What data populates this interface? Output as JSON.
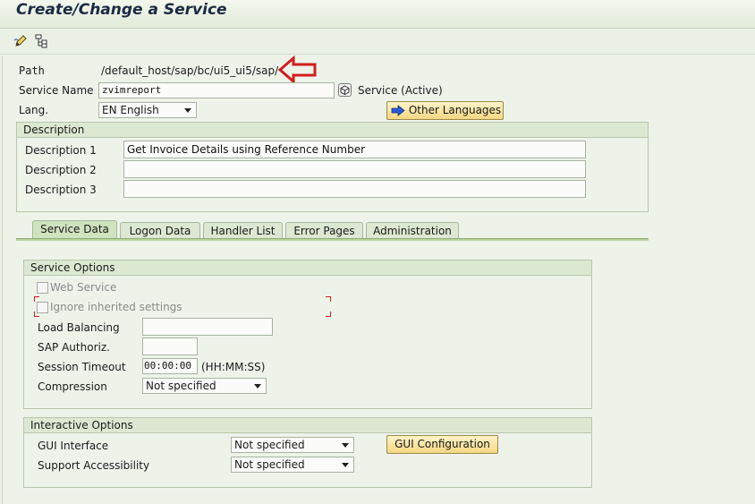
{
  "title": "Create/Change a Service",
  "toolbar": {
    "icons": [
      "edit-pencil-icon",
      "hierarchy-icon"
    ]
  },
  "path": {
    "label": "Path",
    "value": "/default_host/sap/bc/ui5_ui5/sap/"
  },
  "service_name": {
    "label": "Service Name",
    "value": "zvimreport",
    "status": "Service (Active)"
  },
  "lang": {
    "label": "Lang.",
    "value": "EN English",
    "other_languages_button": "Other Languages"
  },
  "description": {
    "header": "Description",
    "rows": [
      {
        "label": "Description 1",
        "value": "Get Invoice Details using Reference Number"
      },
      {
        "label": "Description 2",
        "value": ""
      },
      {
        "label": "Description 3",
        "value": ""
      }
    ]
  },
  "tabs": [
    {
      "label": "Service Data",
      "active": true
    },
    {
      "label": "Logon Data",
      "active": false
    },
    {
      "label": "Handler List",
      "active": false
    },
    {
      "label": "Error Pages",
      "active": false
    },
    {
      "label": "Administration",
      "active": false
    }
  ],
  "service_options": {
    "header": "Service Options",
    "web_service": "Web Service",
    "ignore_inherited": "Ignore inherited settings",
    "load_balancing": {
      "label": "Load Balancing",
      "value": ""
    },
    "sap_authoriz": {
      "label": "SAP Authoriz.",
      "value": ""
    },
    "session_timeout": {
      "label": "Session Timeout",
      "value": "00:00:00",
      "unit": "(HH:MM:SS)"
    },
    "compression": {
      "label": "Compression",
      "value": "Not specified"
    }
  },
  "interactive_options": {
    "header": "Interactive Options",
    "gui_interface": {
      "label": "GUI Interface",
      "value": "Not specified"
    },
    "support_accessibility": {
      "label": "Support Accessibility",
      "value": "Not specified"
    },
    "gui_configuration_button": "GUI Configuration"
  },
  "colors": {
    "background": "#eef3ea",
    "group_header": "#dde8d3",
    "button": "#f5d782",
    "annotation_arrow": "#d21d1d"
  }
}
